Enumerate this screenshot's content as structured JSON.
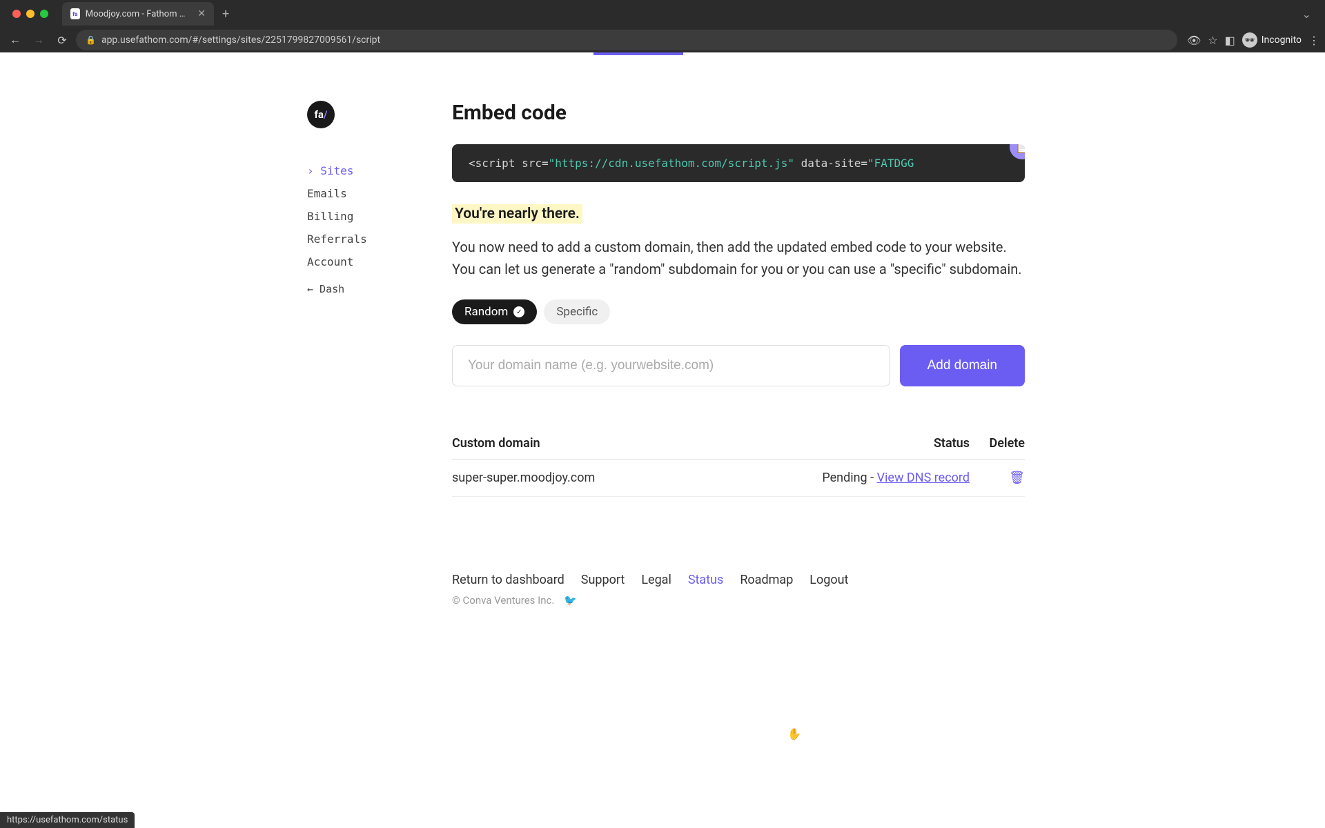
{
  "browser": {
    "tab_title": "Moodjoy.com - Fathom Analyti",
    "url": "app.usefathom.com/#/settings/sites/2251799827009561/script",
    "incognito_label": "Incognito",
    "status_bar": "https://usefathom.com/status"
  },
  "sidebar": {
    "logo_text": "fa",
    "logo_slash": "/",
    "items": [
      {
        "label": "Sites",
        "active": true
      },
      {
        "label": "Emails",
        "active": false
      },
      {
        "label": "Billing",
        "active": false
      },
      {
        "label": "Referrals",
        "active": false
      },
      {
        "label": "Account",
        "active": false
      }
    ],
    "dash_label": "← Dash"
  },
  "main": {
    "heading": "Embed code",
    "code": {
      "prefix": "<script src=",
      "url_q": "\"",
      "url": "https://cdn.usefathom.com/script.js",
      "attr": " data-site=",
      "site_q": "\"",
      "site": "FATDGG"
    },
    "highlight": "You're nearly there.",
    "description": "You now need to add a custom domain, then add the updated embed code to your website. You can let us generate a \"random\" subdomain for you or you can use a \"specific\" subdomain.",
    "toggles": {
      "random": "Random",
      "specific": "Specific"
    },
    "domain_placeholder": "Your domain name (e.g. yourwebsite.com)",
    "add_btn": "Add domain",
    "table": {
      "headers": {
        "domain": "Custom domain",
        "status": "Status",
        "delete": "Delete"
      },
      "rows": [
        {
          "domain": "super-super.moodjoy.com",
          "status_prefix": "Pending - ",
          "status_link": "View DNS record"
        }
      ]
    }
  },
  "footer": {
    "links": [
      {
        "label": "Return to dashboard",
        "hovered": false
      },
      {
        "label": "Support",
        "hovered": false
      },
      {
        "label": "Legal",
        "hovered": false
      },
      {
        "label": "Status",
        "hovered": true
      },
      {
        "label": "Roadmap",
        "hovered": false
      },
      {
        "label": "Logout",
        "hovered": false
      }
    ],
    "copyright": "© Conva Ventures Inc."
  }
}
